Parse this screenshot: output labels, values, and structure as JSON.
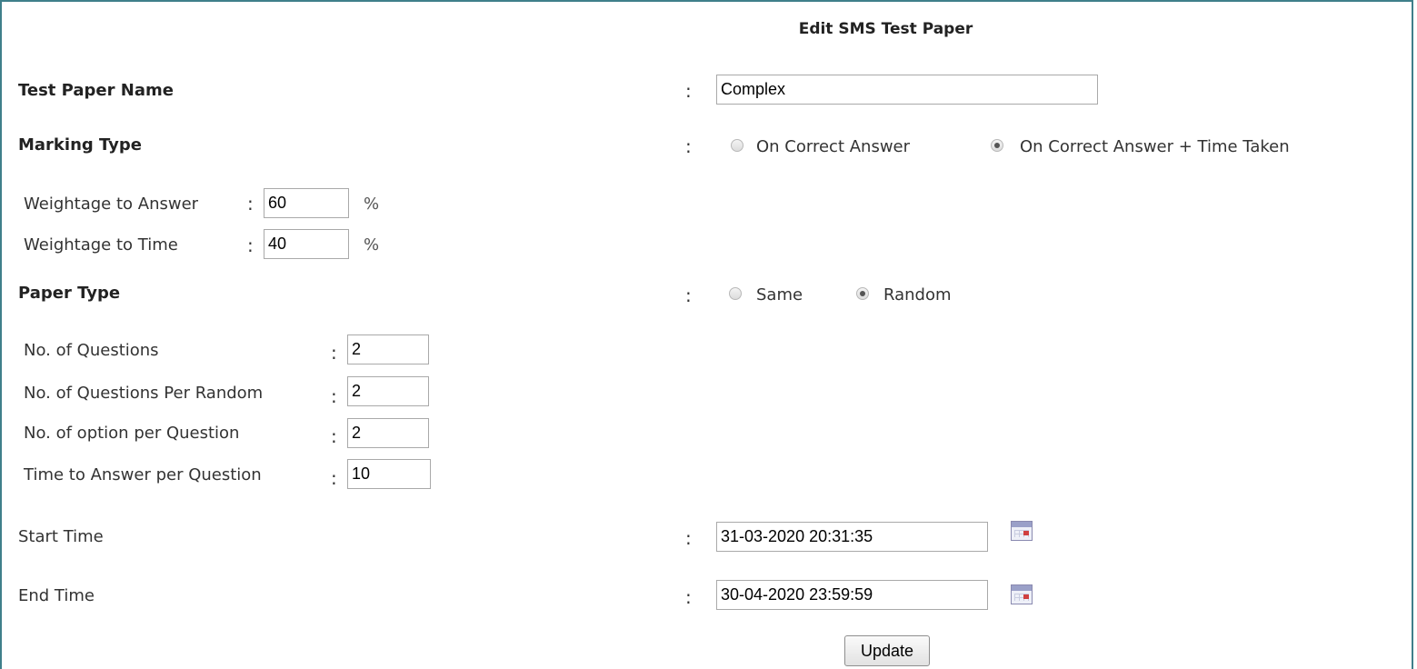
{
  "form": {
    "title": "Edit SMS Test Paper",
    "colon": ":",
    "test_paper_name": {
      "label": "Test Paper Name",
      "value": "Complex"
    },
    "marking_type": {
      "label": "Marking Type",
      "options": [
        "On Correct Answer",
        "On Correct Answer + Time Taken"
      ],
      "selected": "On Correct Answer + Time Taken"
    },
    "weightage_answer": {
      "label": "Weightage to Answer",
      "value": "60",
      "unit": "%"
    },
    "weightage_time": {
      "label": "Weightage to Time",
      "value": "40",
      "unit": "%"
    },
    "paper_type": {
      "label": "Paper Type",
      "options": [
        "Same",
        "Random"
      ],
      "selected": "Random"
    },
    "num_questions": {
      "label": "No. of Questions",
      "value": "2"
    },
    "questions_per_random": {
      "label": "No. of Questions Per Random",
      "value": "2"
    },
    "options_per_question": {
      "label": "No. of option per Question",
      "value": "2"
    },
    "time_per_question": {
      "label": "Time to Answer per Question",
      "value": "10"
    },
    "start_time": {
      "label": "Start Time",
      "value": "31-03-2020 20:31:35",
      "icon": "calendar-icon"
    },
    "end_time": {
      "label": "End Time",
      "value": "30-04-2020 23:59:59",
      "icon": "calendar-icon"
    },
    "update_button": "Update"
  },
  "colors": {
    "frame_border": "#3f7f8a"
  }
}
